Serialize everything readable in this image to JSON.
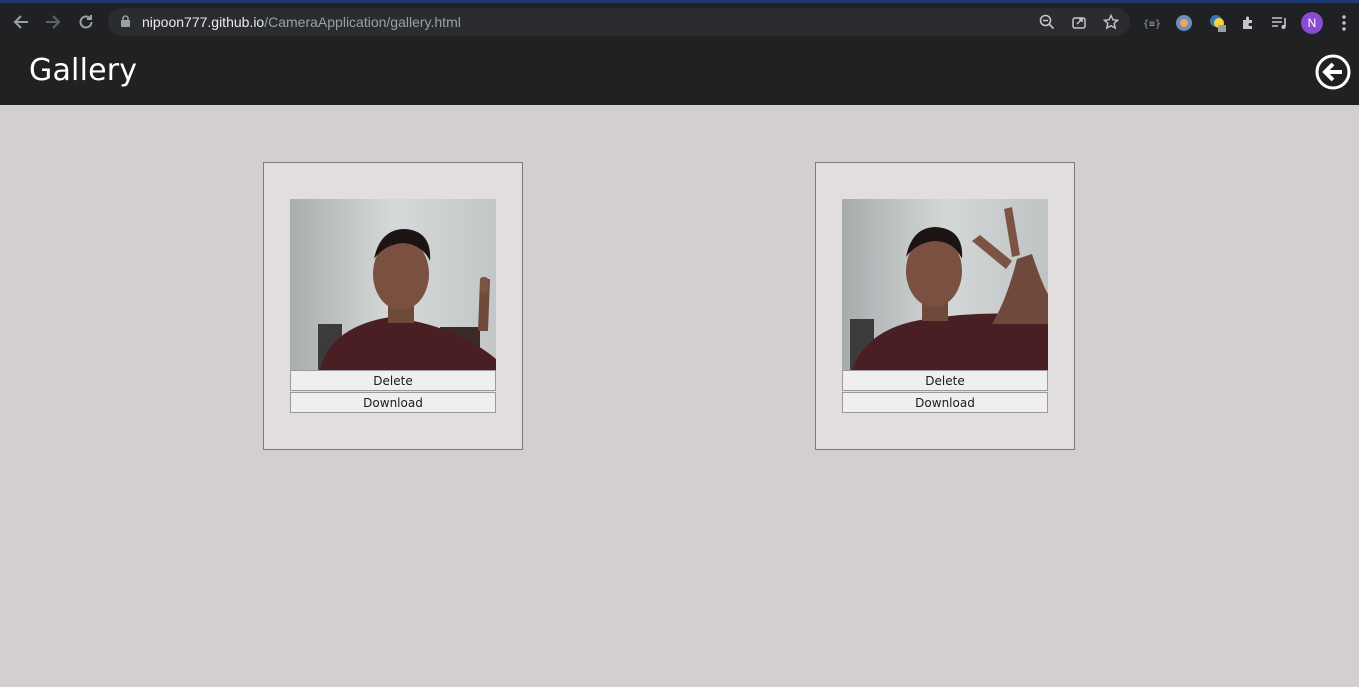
{
  "browser": {
    "url_host": "nipoon777.github.io",
    "url_path": "/CameraApplication/gallery.html",
    "profile_initial": "N"
  },
  "header": {
    "title": "Gallery"
  },
  "gallery": {
    "items": [
      {
        "delete_label": "Delete",
        "download_label": "Download",
        "pose": "pointing-finger"
      },
      {
        "delete_label": "Delete",
        "download_label": "Download",
        "pose": "peace-sign"
      }
    ]
  },
  "colors": {
    "page_background": "#d3cfce",
    "header_background": "#212121",
    "card_background": "#e2dedf",
    "button_background": "#efefef"
  }
}
